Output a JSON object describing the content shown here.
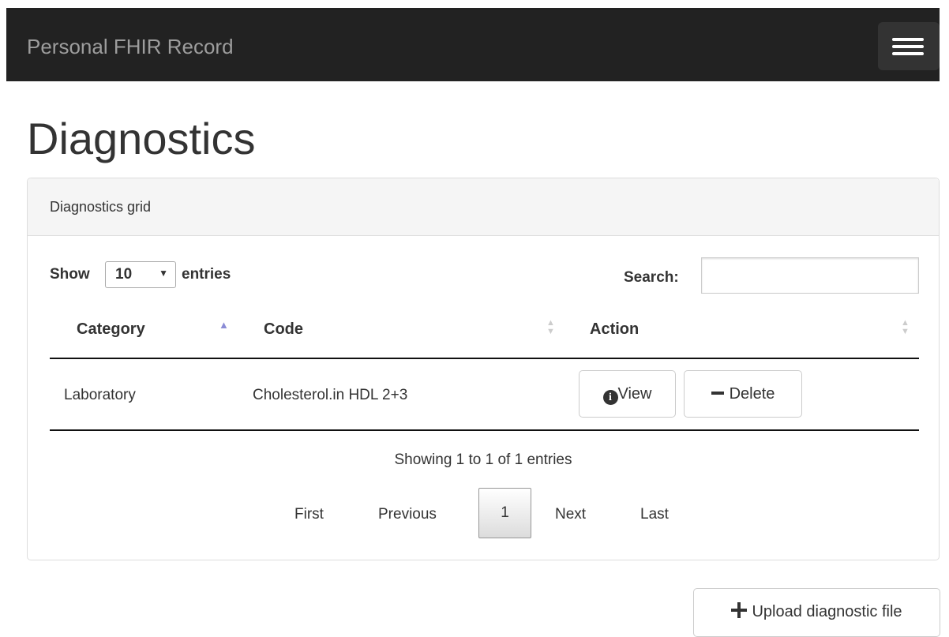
{
  "navbar": {
    "brand": "Personal FHIR Record",
    "toggle_icon": "hamburger-menu-icon"
  },
  "page": {
    "title": "Diagnostics"
  },
  "panel": {
    "heading": "Diagnostics grid"
  },
  "table_controls": {
    "show_label": "Show",
    "entries_value": "10",
    "entries_options": [
      "10"
    ],
    "entries_label": "entries",
    "search_label": "Search:",
    "search_value": ""
  },
  "table": {
    "columns": [
      {
        "label": "Category",
        "sort_icon": "sort-asc-icon"
      },
      {
        "label": "Code",
        "sort_icon": "sort-both-icon"
      },
      {
        "label": "Action",
        "sort_icon": "sort-both-icon"
      }
    ],
    "rows": [
      {
        "category": "Laboratory",
        "code": "Cholesterol.in HDL 2+3",
        "view_label": "View",
        "delete_label": "Delete"
      }
    ]
  },
  "info": "Showing 1 to 1 of 1 entries",
  "pagination": {
    "first": "First",
    "previous": "Previous",
    "current": "1",
    "next": "Next",
    "last": "Last"
  },
  "upload_button": {
    "label": "Upload diagnostic file",
    "icon": "plus-icon"
  },
  "colors": {
    "navbar_bg": "#222222",
    "brand_text": "#9d9d9d",
    "sort_active": "#8b8cd6",
    "sort_inactive": "#cccccc",
    "panel_heading_bg": "#f5f5f5"
  }
}
